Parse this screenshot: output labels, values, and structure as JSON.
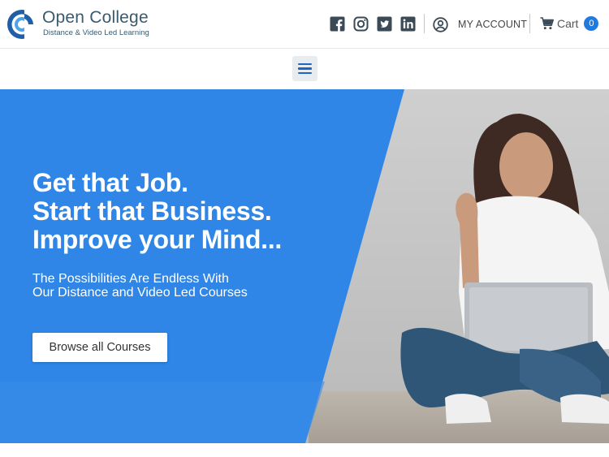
{
  "brand": {
    "name": "Open College",
    "tagline": "Distance & Video Led Learning",
    "colors": {
      "primary": "#2f86e6",
      "logo_dark": "#1f5fa8",
      "text": "#3a5a6e"
    }
  },
  "header": {
    "social_icons": [
      "facebook-icon",
      "instagram-icon",
      "twitter-icon",
      "linkedin-icon"
    ],
    "account_label": "MY ACCOUNT",
    "cart_label": "Cart",
    "cart_count": "0"
  },
  "nav": {
    "menu_icon": "hamburger-icon"
  },
  "hero": {
    "headline": [
      "Get that Job.",
      "Start that Business.",
      "Improve your Mind..."
    ],
    "subline": [
      "The Possibilities Are Endless With",
      "Our Distance and Video Led Courses"
    ],
    "cta_label": "Browse all Courses"
  }
}
